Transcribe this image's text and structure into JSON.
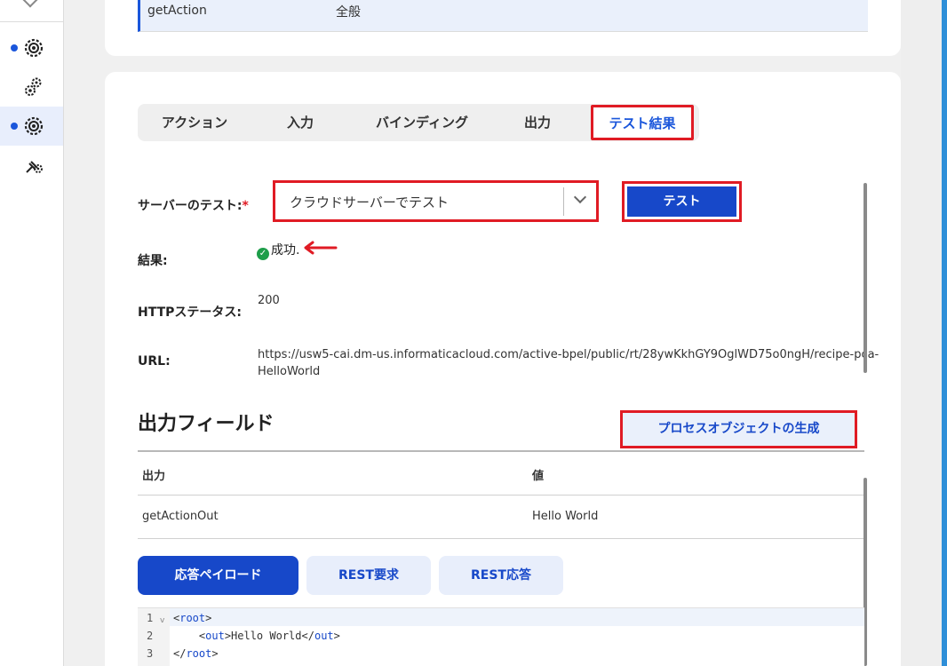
{
  "rail": {
    "items": [
      {
        "name": "rail-item-1",
        "icon": "gear-icon",
        "active": false,
        "dot": true
      },
      {
        "name": "rail-item-2",
        "icon": "gears-icon",
        "active": false,
        "dot": false
      },
      {
        "name": "rail-item-3",
        "icon": "gear-icon",
        "active": true,
        "dot": true
      },
      {
        "name": "rail-item-4",
        "icon": "plug-gear-icon",
        "active": false,
        "dot": false
      }
    ]
  },
  "top_row": {
    "action": "getAction",
    "category": "全般"
  },
  "tabs": [
    "アクション",
    "入力",
    "バインディング",
    "出力",
    "テスト結果"
  ],
  "active_tab": 4,
  "form": {
    "server_label": "サーバーのテスト:",
    "required_mark": "*",
    "server_value": "クラウドサーバーでテスト",
    "test_button": "テスト",
    "result_label": "結果:",
    "result_value": "成功.",
    "http_label": "HTTPステータス:",
    "http_value": "200",
    "url_label": "URL:",
    "url_line1": "https://usw5-cai.dm-us.informaticacloud.com/active-bpel/public/rt/28ywKkhGY9OglWD75o0ngH/recipe-pca-",
    "url_line2": "HelloWorld"
  },
  "output": {
    "title": "出力フィールド",
    "generate_button": "プロセスオブジェクトの生成",
    "headers": [
      "出力",
      "値"
    ],
    "rows": [
      [
        "getActionOut",
        "Hello World"
      ]
    ]
  },
  "payload_tabs": [
    "応答ペイロード",
    "REST要求",
    "REST応答"
  ],
  "code": {
    "lines": [
      "1",
      "2",
      "3"
    ],
    "l1_open": "<",
    "l1_tag": "root",
    "l1_close": ">",
    "l2_indent": "    <",
    "l2_tag": "out",
    "l2_mid": ">Hello World</",
    "l2_tag2": "out",
    "l2_close": ">",
    "l3_open": "</",
    "l3_tag": "root",
    "l3_close": ">"
  },
  "colors": {
    "primary": "#1748c9",
    "highlight": "#e01b24",
    "success": "#1e9e4a"
  }
}
